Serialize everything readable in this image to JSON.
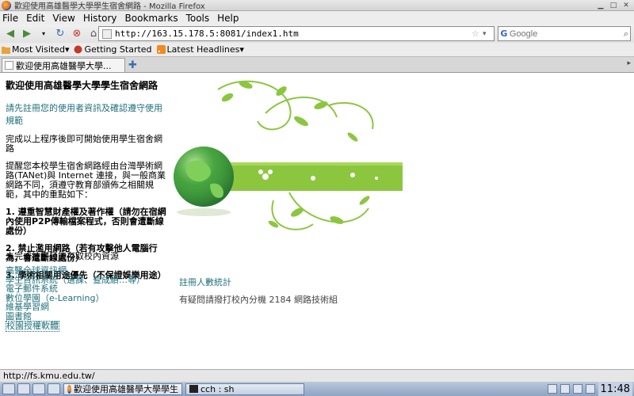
{
  "window": {
    "title": "歡迎使用高雄醫學大學學生宿舍網路 - Mozilla Firefox"
  },
  "menu": [
    "File",
    "Edit",
    "View",
    "History",
    "Bookmarks",
    "Tools",
    "Help"
  ],
  "nav": {
    "url": "http://163.15.178.5:8081/index1.htm",
    "search_placeholder": "Google",
    "search_engine": "G"
  },
  "bookmarks": [
    "Most Visited▾",
    "Getting Started",
    "Latest Headlines▾"
  ],
  "tab": {
    "label": "歡迎使用高雄醫學大學..."
  },
  "page": {
    "heading": "歡迎使用高雄醫學大學學生宿舍網路",
    "register_link": "請先註冊您的使用者資訊及確認遵守使用規範",
    "after_text": "完成以上程序後即可開始使用學生宿舍網路",
    "reminder": "提醒您本校學生宿舍網路經由台灣學術網路(TANet)與 Internet 連接，與一般商業網路不同，須遵守教育部頒佈之相關規範，其中的重點如下：",
    "rule1": "1. 遵重智慧財產權及著作權（請勿在宿網內使用P2P傳輸檔案程式，否則會遭斷線處份）",
    "rule2": "2. 禁止濫用網路（若有攻擊他人電腦行為，會遭斷線處份）",
    "rule3": "3. 學術相關用途優先（不保證娛樂用途）",
    "notice": "未完成註冊只能存取校內資源",
    "links": [
      "高醫全球資訊網",
      "學生資訊系統（選課、查成績…等）",
      "電子郵件系統",
      "數位學園（e-Learning）",
      "維基學習網",
      "圖書館",
      "校園授權軟體"
    ],
    "stats_link": "註冊人數統計",
    "contact": "有疑問請撥打校內分機 2184 網路技術組"
  },
  "status": {
    "text": "http://fs.kmu.edu.tw/"
  },
  "taskbar": {
    "task1": "歡迎使用高雄醫學大學學生",
    "task2": "cch : sh",
    "clock": "11:48"
  },
  "colors": {
    "link_teal": "#1f6f7a",
    "banner_green": "#8cc63f"
  }
}
